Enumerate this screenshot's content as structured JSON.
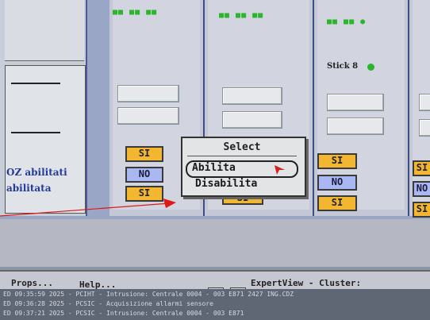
{
  "left_panel": {
    "label1": "OZ abilitati",
    "label2": "abilitata"
  },
  "columns": [
    {
      "status": "■■ ■■ ■■",
      "si_top": "SI",
      "no": "NO",
      "si_bottom": "SI"
    },
    {
      "status": "■■ ■■ ■■",
      "si_bottom": "SI"
    },
    {
      "status": "■■ ■■ ●",
      "stick_label": "Stick 8",
      "si_top": "SI",
      "no": "NO",
      "si_bottom": "SI"
    },
    {
      "si_top": "SI",
      "no": "NO",
      "si_bottom": "SI"
    }
  ],
  "popup": {
    "title": "Select",
    "items": [
      "Abilita",
      "Disabilita"
    ]
  },
  "toolbar": {
    "props": "Props...",
    "help": "Help...",
    "title": "ExpertView - Cluster:"
  },
  "log": [
    "ED 09:35:59 2025 - PCIHT - Intrusione: Centrale 0004 - 003 E871 2427 ING.CDZ",
    "ED 09:36:28 2025 - PCSIC - Acquisizione allarmi sensore",
    "ED 09:37:21 2025 - PCSIC - Intrusione: Centrale 0004 - 003 E871"
  ],
  "colors": {
    "si": "#f2b631",
    "no": "#a9b8f2",
    "status_green": "#2bb52b",
    "frame": "#3e4c84"
  }
}
